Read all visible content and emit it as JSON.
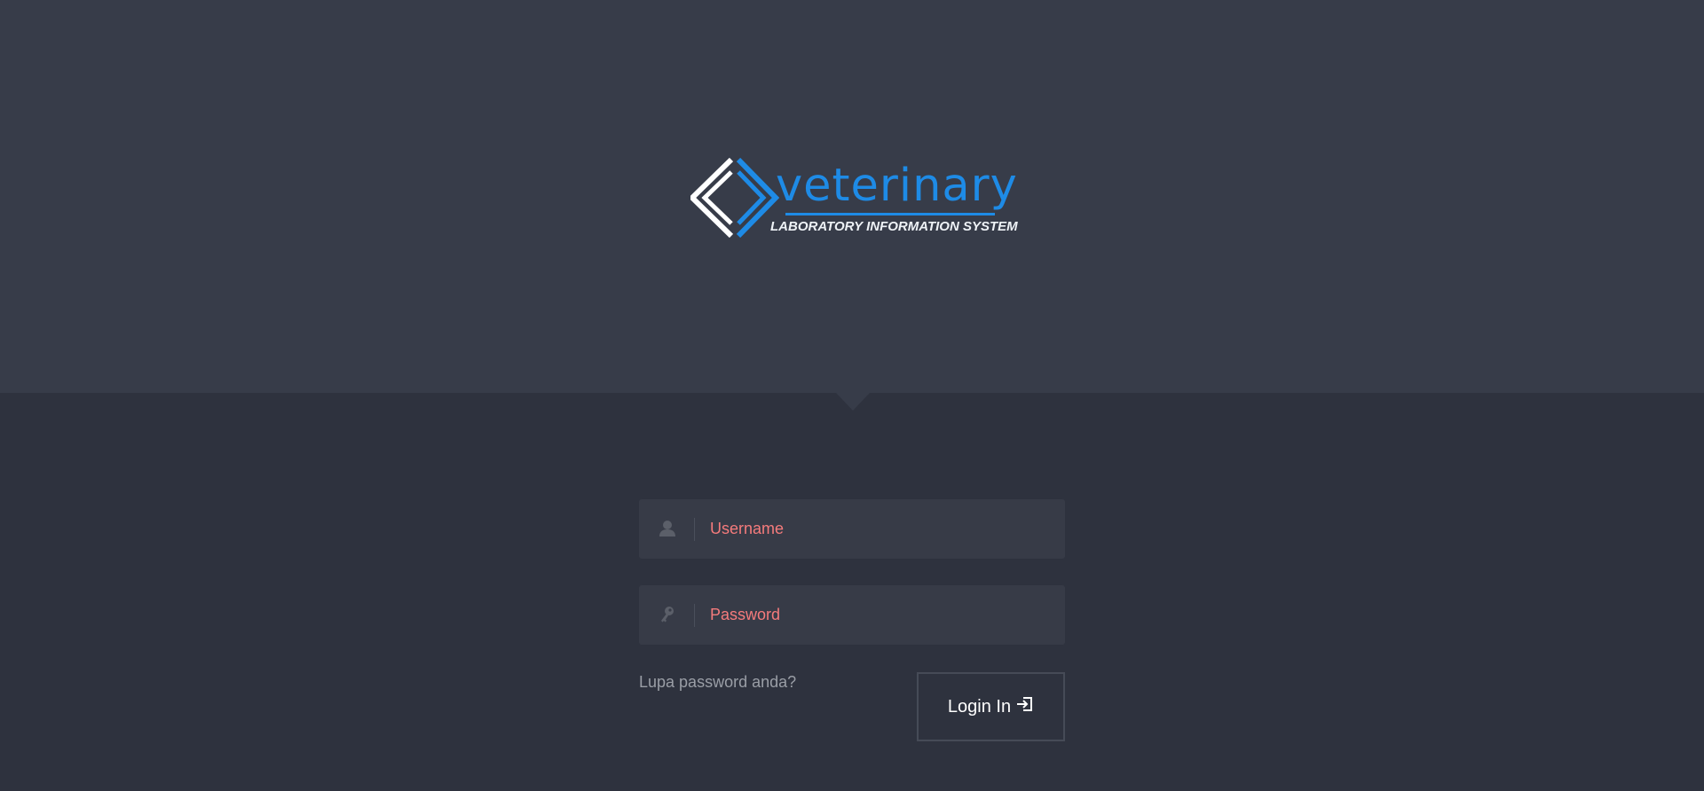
{
  "logo": {
    "brand": "veterinary",
    "tagline": "LABORATORY INFORMATION SYSTEM"
  },
  "login_form": {
    "username_placeholder": "Username",
    "username_value": "",
    "password_placeholder": "Password",
    "password_value": "",
    "forgot_link": "Lupa password anda?",
    "login_button": "Login In"
  },
  "icons": {
    "username": "user-icon",
    "password": "key-icon",
    "login": "sign-in-icon"
  },
  "colors": {
    "header_bg": "#373c49",
    "page_bg": "#2e323e",
    "field_bg": "#373b47",
    "placeholder": "#f57b7c",
    "brand_blue": "#1e8be6"
  }
}
